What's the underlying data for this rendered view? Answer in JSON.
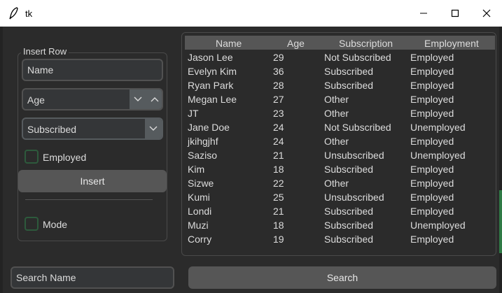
{
  "window": {
    "title": "tk"
  },
  "form": {
    "frame_label": "Insert Row",
    "name_placeholder": "Name",
    "age_value": "Age",
    "subscription_value": "Subscribed",
    "employed_label": "Employed",
    "insert_label": "Insert",
    "mode_label": "Mode"
  },
  "table": {
    "columns": [
      "Name",
      "Age",
      "Subscription",
      "Employment"
    ],
    "rows": [
      [
        "Jason Lee",
        "29",
        "Not Subscribed",
        "Employed"
      ],
      [
        "Evelyn Kim",
        "36",
        "Subscribed",
        "Employed"
      ],
      [
        "Ryan Park",
        "28",
        "Subscribed",
        "Employed"
      ],
      [
        "Megan Lee",
        "27",
        "Other",
        "Employed"
      ],
      [
        "JT",
        "23",
        "Other",
        "Employed"
      ],
      [
        "Jane Doe",
        "24",
        "Not Subscribed",
        "Unemployed"
      ],
      [
        "jkihgjhf",
        "24",
        "Other",
        "Employed"
      ],
      [
        "Saziso",
        "21",
        "Unsubscribed",
        "Unemployed"
      ],
      [
        "Kim",
        "18",
        "Subscribed",
        "Employed"
      ],
      [
        "Sizwe",
        "22",
        "Other",
        "Employed"
      ],
      [
        "Kumi",
        "25",
        "Unsubscribed",
        "Employed"
      ],
      [
        "Londi",
        "21",
        "Subscribed",
        "Employed"
      ],
      [
        "Muzi",
        "18",
        "Subscribed",
        "Unemployed"
      ],
      [
        "Corry",
        "19",
        "Subscribed",
        "Employed"
      ]
    ]
  },
  "search": {
    "placeholder": "Search Name",
    "button_label": "Search"
  },
  "colors": {
    "background": "#2b2b2b",
    "button": "#565656",
    "checkbox_border": "#2d5a3c"
  }
}
